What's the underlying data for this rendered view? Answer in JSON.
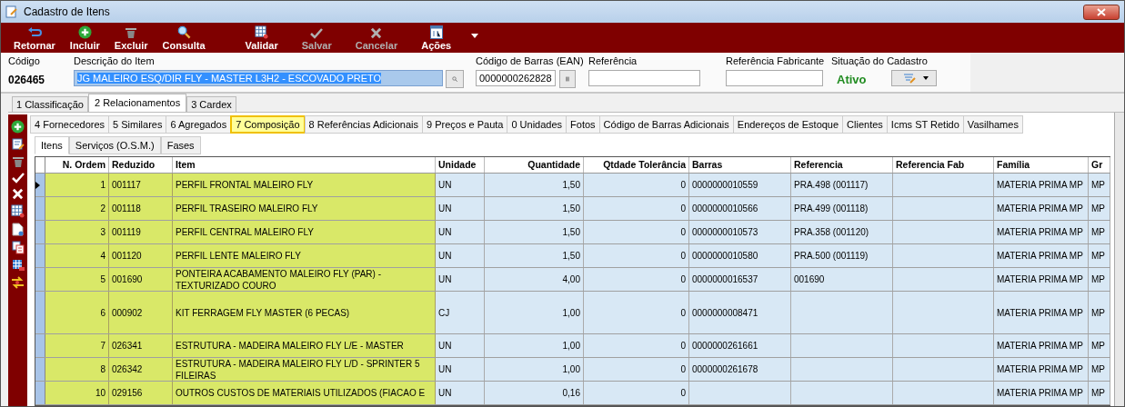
{
  "window": {
    "title": "Cadastro de Itens"
  },
  "toolbar": [
    {
      "label": "Retornar",
      "disabled": false
    },
    {
      "label": "Incluir",
      "disabled": false
    },
    {
      "label": "Excluir",
      "disabled": false
    },
    {
      "label": "Consulta",
      "disabled": false
    },
    {
      "label": "Validar",
      "disabled": false
    },
    {
      "label": "Salvar",
      "disabled": true
    },
    {
      "label": "Cancelar",
      "disabled": true
    },
    {
      "label": "Ações",
      "disabled": false
    }
  ],
  "header": {
    "codigo": {
      "label": "Código",
      "value": "026465"
    },
    "descricao": {
      "label": "Descrição do Item",
      "value": "JG MALEIRO ESQ/DIR FLY - MASTER L3H2 - ESCOVADO PRETO"
    },
    "ean": {
      "label": "Código de Barras (EAN)",
      "value": "0000000262828"
    },
    "referencia": {
      "label": "Referência"
    },
    "ref_fabricante": {
      "label": "Referência Fabricante"
    },
    "situacao": {
      "label": "Situação do Cadastro",
      "value": "Ativo"
    }
  },
  "tabs": [
    {
      "label": "1 Classificação",
      "selected": false
    },
    {
      "label": "2 Relacionamentos",
      "selected": true
    },
    {
      "label": "3 Cardex",
      "selected": false
    }
  ],
  "subtabs": [
    {
      "label": "4 Fornecedores",
      "selected": false
    },
    {
      "label": "5 Similares",
      "selected": false
    },
    {
      "label": "6 Agregados",
      "selected": false
    },
    {
      "label": "7 Composição",
      "selected": true
    },
    {
      "label": "8 Referências Adicionais",
      "selected": false
    },
    {
      "label": "9 Preços e Pauta",
      "selected": false
    },
    {
      "label": "0 Unidades",
      "selected": false
    },
    {
      "label": "Fotos",
      "selected": false
    },
    {
      "label": "Código de Barras Adicionais",
      "selected": false
    },
    {
      "label": "Endereços de Estoque",
      "selected": false
    },
    {
      "label": "Clientes",
      "selected": false
    },
    {
      "label": "Icms ST Retido",
      "selected": false
    },
    {
      "label": "Vasilhames",
      "selected": false
    }
  ],
  "inner_tabs": [
    {
      "label": "Itens",
      "selected": true
    },
    {
      "label": "Serviços (O.S.M.)",
      "selected": false
    },
    {
      "label": "Fases",
      "selected": false
    }
  ],
  "table": {
    "columns": [
      {
        "label": "N. Ordem",
        "highlighted": true
      },
      {
        "label": "Reduzido",
        "highlighted": true
      },
      {
        "label": "Item",
        "highlighted": true
      },
      {
        "label": "Unidade",
        "highlighted": false
      },
      {
        "label": "Quantidade",
        "highlighted": false
      },
      {
        "label": "Qtdade Tolerância",
        "highlighted": false
      },
      {
        "label": "Barras",
        "highlighted": false
      },
      {
        "label": "Referencia",
        "highlighted": false
      },
      {
        "label": "Referencia Fab",
        "highlighted": false
      },
      {
        "label": "Família",
        "highlighted": false
      },
      {
        "label": "Gr",
        "highlighted": false
      }
    ],
    "rows": [
      {
        "current": true,
        "tall": false,
        "cells": [
          "1",
          "001117",
          "PERFIL FRONTAL MALEIRO FLY",
          "UN",
          "1,50",
          "0",
          "0000000010559",
          "PRA.498 (001117)",
          null,
          "MATERIA PRIMA MP",
          "MP"
        ]
      },
      {
        "current": false,
        "tall": false,
        "cells": [
          "2",
          "001118",
          "PERFIL TRASEIRO MALEIRO FLY",
          "UN",
          "1,50",
          "0",
          "0000000010566",
          "PRA.499 (001118)",
          null,
          "MATERIA PRIMA MP",
          "MP"
        ]
      },
      {
        "current": false,
        "tall": false,
        "cells": [
          "3",
          "001119",
          "PERFIL CENTRAL MALEIRO FLY",
          "UN",
          "1,50",
          "0",
          "0000000010573",
          "PRA.358 (001120)",
          null,
          "MATERIA PRIMA MP",
          "MP"
        ]
      },
      {
        "current": false,
        "tall": false,
        "cells": [
          "4",
          "001120",
          "PERFIL LENTE MALEIRO FLY",
          "UN",
          "1,50",
          "0",
          "0000000010580",
          "PRA.500 (001119)",
          null,
          "MATERIA PRIMA MP",
          "MP"
        ]
      },
      {
        "current": false,
        "tall": false,
        "cells": [
          "5",
          "001690",
          "PONTEIRA ACABAMENTO MALEIRO FLY (PAR) - TEXTURIZADO COURO",
          "UN",
          "4,00",
          "0",
          "0000000016537",
          "001690",
          null,
          "MATERIA PRIMA MP",
          "MP"
        ]
      },
      {
        "current": false,
        "tall": true,
        "cells": [
          "6",
          "000902",
          "KIT FERRAGEM FLY MASTER (6 PECAS)",
          "CJ",
          "1,00",
          "0",
          "0000000008471",
          null,
          null,
          "MATERIA PRIMA MP",
          "MP"
        ]
      },
      {
        "current": false,
        "tall": false,
        "cells": [
          "7",
          "026341",
          "ESTRUTURA - MADEIRA MALEIRO FLY L/E - MASTER",
          "UN",
          "1,00",
          "0",
          "0000000261661",
          null,
          null,
          "MATERIA PRIMA MP",
          "MP"
        ]
      },
      {
        "current": false,
        "tall": false,
        "cells": [
          "8",
          "026342",
          "ESTRUTURA - MADEIRA MALEIRO FLY L/D - SPRINTER 5 FILEIRAS",
          "UN",
          "1,00",
          "0",
          "0000000261678",
          null,
          null,
          "MATERIA PRIMA MP",
          "MP"
        ]
      },
      {
        "current": false,
        "tall": false,
        "cells": [
          "10",
          "029156",
          "OUTROS CUSTOS DE MATERIAIS UTILIZADOS (FIACAO E",
          "UN",
          "0,16",
          "0",
          null,
          null,
          null,
          "MATERIA PRIMA MP",
          "MP"
        ]
      }
    ]
  }
}
